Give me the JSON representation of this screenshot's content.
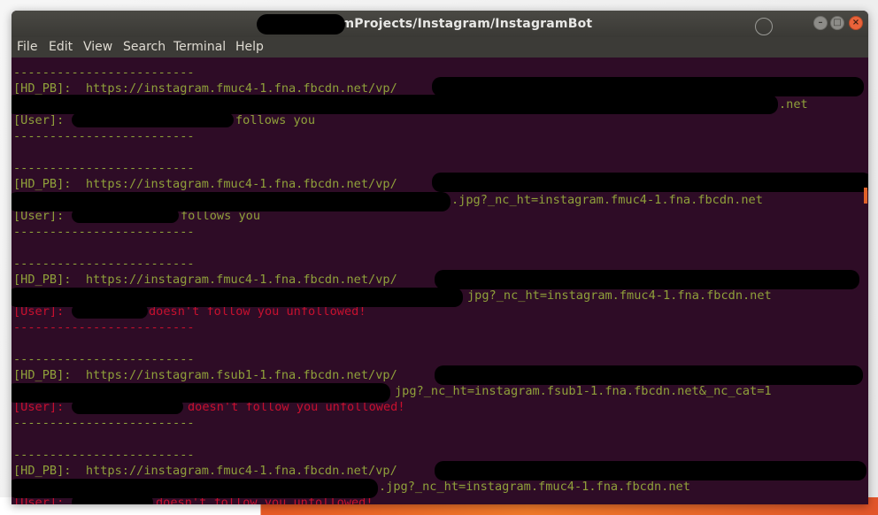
{
  "window": {
    "title": "PycharmProjects/Instagram/InstagramBot",
    "title_prefix_visible": "/",
    "controls": [
      "minimize-icon",
      "maximize-icon",
      "close-icon"
    ]
  },
  "menu": [
    "File",
    "Edit",
    "View",
    "Search",
    "Terminal",
    "Help"
  ],
  "terminal": {
    "colors": {
      "background": "#2e0c26",
      "green": "#8fa03a",
      "red": "#c8102e"
    },
    "separator": "-------------------------",
    "blocks": [
      {
        "hd": "[HD_PB]:  https://instagram.fmuc4-1.fna.fbcdn.net/vp/",
        "url_tail": ".net",
        "user_label": "[User]:",
        "status": "follows you",
        "follows": true
      },
      {
        "hd": "[HD_PB]:  https://instagram.fmuc4-1.fna.fbcdn.net/vp/",
        "url_tail": ".jpg?_nc_ht=instagram.fmuc4-1.fna.fbcdn.net",
        "user_label": "[User]:",
        "status": "follows you",
        "follows": true
      },
      {
        "hd": "[HD_PB]:  https://instagram.fmuc4-1.fna.fbcdn.net/vp/",
        "url_tail": "jpg?_nc_ht=instagram.fmuc4-1.fna.fbcdn.net",
        "user_label": "[User]:",
        "status": "doesn't follow you unfollowed!",
        "follows": false
      },
      {
        "hd": "[HD_PB]:  https://instagram.fsub1-1.fna.fbcdn.net/vp/",
        "url_tail": "jpg?_nc_ht=instagram.fsub1-1.fna.fbcdn.net&_nc_cat=1",
        "user_label": "[User]:",
        "status": "doesn't follow you unfollowed!",
        "follows": false
      },
      {
        "hd": "[HD_PB]:  https://instagram.fmuc4-1.fna.fbcdn.net/vp/",
        "url_tail": ".jpg?_nc_ht=instagram.fmuc4-1.fna.fbcdn.net",
        "user_label": "[User]:",
        "status": "doesn't follow you unfollowed!",
        "follows": false
      }
    ]
  }
}
